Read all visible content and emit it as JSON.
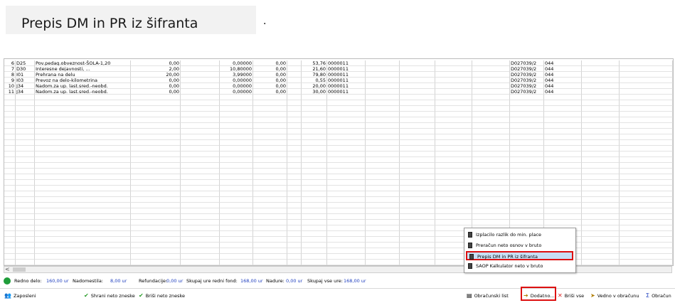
{
  "header": {
    "title": "Prepis DM in PR iz šifranta",
    "dot": "."
  },
  "rows": [
    {
      "no": "6",
      "code": "D25",
      "desc": "Pov.pedag.obveznost-ŠOLA-1,20",
      "a": "0,00",
      "b": "0,00000",
      "c": "0,00",
      "amount": "53,76",
      "ref": "0000011",
      "doc": "D027039/2",
      "k": "044"
    },
    {
      "no": "7",
      "code": "D30",
      "desc": "Interesne dejavnosti, …",
      "a": "2,00",
      "b": "10,80000",
      "c": "0,00",
      "amount": "21,60",
      "ref": "0000011",
      "doc": "D027039/2",
      "k": "044"
    },
    {
      "no": "8",
      "code": "I01",
      "desc": "Prehrana na delu",
      "a": "20,00",
      "b": "3,99000",
      "c": "0,00",
      "amount": "79,80",
      "ref": "0000011",
      "doc": "D027039/2",
      "k": "044"
    },
    {
      "no": "9",
      "code": "I03",
      "desc": "Prevoz na delo-kilometrina",
      "a": "0,00",
      "b": "0,00000",
      "c": "0,00",
      "amount": "0,55",
      "ref": "0000011",
      "doc": "D027039/2",
      "k": "044"
    },
    {
      "no": "10",
      "code": "J34",
      "desc": "Nadom.za up. last.sred.-neobd.",
      "a": "0,00",
      "b": "0,00000",
      "c": "0,00",
      "amount": "20,00",
      "ref": "0000011",
      "doc": "D027039/2",
      "k": "044"
    },
    {
      "no": "11",
      "code": "J34",
      "desc": "Nadom.za up. last.sred.-neobd.",
      "a": "0,00",
      "b": "0,00000",
      "c": "0,00",
      "amount": "30,00",
      "ref": "0000011",
      "doc": "D027039/2",
      "k": "044"
    }
  ],
  "status": {
    "redno_label": "Redno delo:",
    "redno_val": "160,00 ur",
    "nadom_label": "Nadomestila:",
    "nadom_val": "8,00 ur",
    "ref_label": "Refundacije:",
    "ref_val": "0,00 ur",
    "skupaj_label": "Skupaj ure redni fond:",
    "skupaj_val": "168,00 ur",
    "nadure_label": "Nadure:",
    "nadure_val": "0,00 ur",
    "vse_label": "Skupaj vse ure:",
    "vse_val": "168,00 ur"
  },
  "toolbar": {
    "zaposleni": "Zaposleni",
    "shrani": "Shrani neto zneske",
    "brisi_neto": "Briši neto zneske",
    "obracunski": "Obračunski list",
    "dodatno": "Dodatno...",
    "brisi_vse": "Briši vse",
    "vedno": "Vedno v obračunu",
    "obracun": "Obračun"
  },
  "menu": [
    "Izplacilo razlik do min. place",
    "Preračun neto osnov v bruto",
    "Prepis DM in PR iz šifranta",
    "SAOP Kalkulator neto v bruto"
  ],
  "menu_selected": 2,
  "colors": {
    "selection_border": "#dd1111",
    "status_value": "#1f3fbf",
    "status_ok": "#1f9d3a"
  },
  "icons": {
    "scroll_left": "<"
  }
}
